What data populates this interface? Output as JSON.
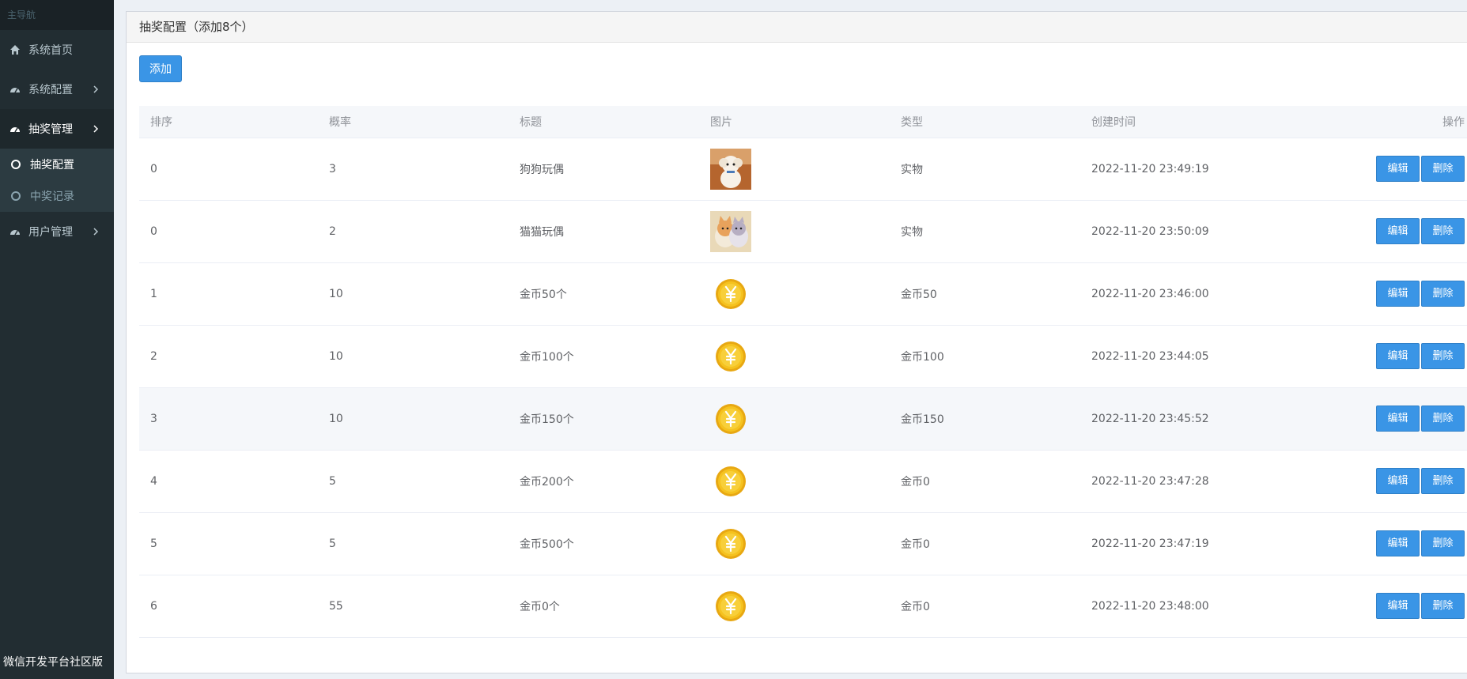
{
  "sidebar": {
    "header": "主导航",
    "items": [
      {
        "label": "系统首页"
      },
      {
        "label": "系统配置"
      },
      {
        "label": "抽奖管理"
      },
      {
        "label": "用户管理"
      }
    ],
    "sub_items": [
      {
        "label": "抽奖配置"
      },
      {
        "label": "中奖记录"
      }
    ],
    "footer": "微信开发平台社区版"
  },
  "box": {
    "title": "抽奖配置（添加8个）",
    "add_label": "添加"
  },
  "table": {
    "headers": [
      "排序",
      "概率",
      "标题",
      "图片",
      "类型",
      "创建时间",
      "操作"
    ],
    "edit_label": "编辑",
    "delete_label": "删除",
    "rows": [
      {
        "sort": "0",
        "prob": "3",
        "title": "狗狗玩偶",
        "image": "dog-toy-photo",
        "type": "实物",
        "created": "2022-11-20 23:49:19"
      },
      {
        "sort": "0",
        "prob": "2",
        "title": "猫猫玩偶",
        "image": "cat-toy-photo",
        "type": "实物",
        "created": "2022-11-20 23:50:09"
      },
      {
        "sort": "1",
        "prob": "10",
        "title": "金币50个",
        "image": "gold-coin-icon",
        "type": "金币50",
        "created": "2022-11-20 23:46:00"
      },
      {
        "sort": "2",
        "prob": "10",
        "title": "金币100个",
        "image": "gold-coin-icon",
        "type": "金币100",
        "created": "2022-11-20 23:44:05"
      },
      {
        "sort": "3",
        "prob": "10",
        "title": "金币150个",
        "image": "gold-coin-icon",
        "type": "金币150",
        "created": "2022-11-20 23:45:52"
      },
      {
        "sort": "4",
        "prob": "5",
        "title": "金币200个",
        "image": "gold-coin-icon",
        "type": "金币0",
        "created": "2022-11-20 23:47:28"
      },
      {
        "sort": "5",
        "prob": "5",
        "title": "金币500个",
        "image": "gold-coin-icon",
        "type": "金币0",
        "created": "2022-11-20 23:47:19"
      },
      {
        "sort": "6",
        "prob": "55",
        "title": "金币0个",
        "image": "gold-coin-icon",
        "type": "金币0",
        "created": "2022-11-20 23:48:00"
      }
    ]
  },
  "colors": {
    "sidebar_bg": "#222d32",
    "primary_button": "#3a95e6",
    "coin_gold": "#f2b81c"
  }
}
